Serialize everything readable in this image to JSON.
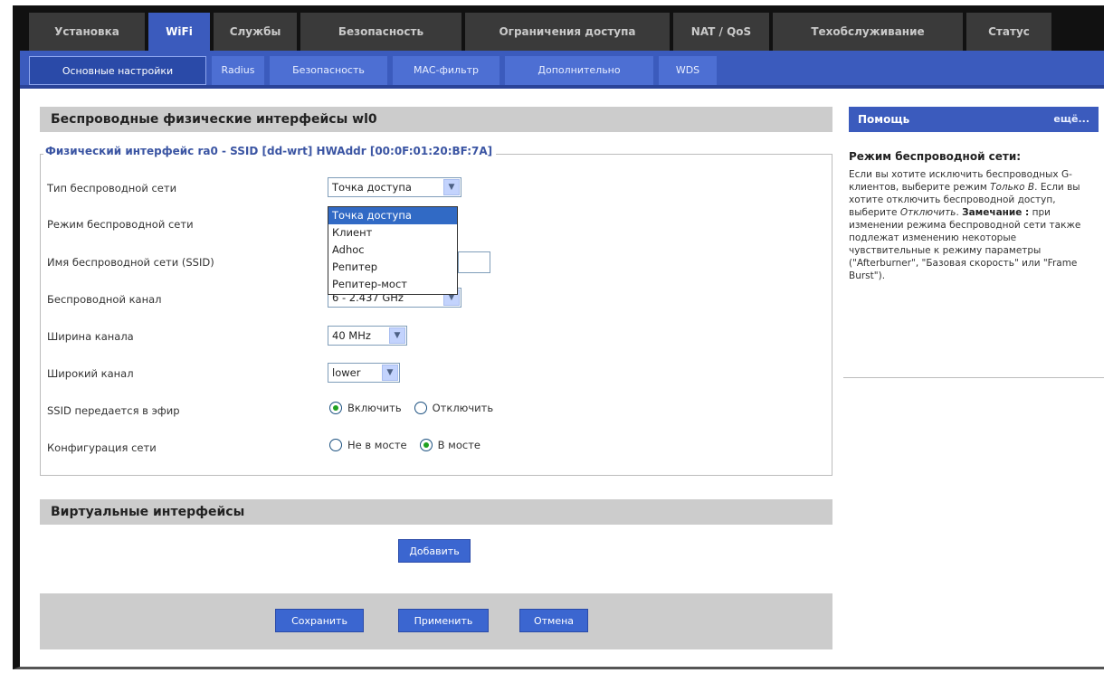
{
  "top_tabs": [
    "Установка",
    "WiFi",
    "Службы",
    "Безопасность",
    "Ограничения доступа",
    "NAT / QoS",
    "Техобслуживание",
    "Статус"
  ],
  "sub_tabs": [
    "Основные настройки",
    "Radius",
    "Безопасность",
    "MAC-фильтр",
    "Дополнительно",
    "WDS"
  ],
  "section": {
    "title": "Беспроводные физические интерфейсы wl0",
    "legend": "Физический интерфейс ra0 - SSID [dd-wrt] HWAddr [00:0F:01:20:BF:7A]"
  },
  "fields": {
    "wireless_type_label": "Тип беспроводной сети",
    "wireless_type_value": "Точка доступа",
    "wireless_mode_label": "Режим беспроводной сети",
    "ssid_label": "Имя беспроводной сети (SSID)",
    "channel_label": "Беспроводной канал",
    "channel_value": "6 - 2.437 GHz",
    "width_label": "Ширина канала",
    "width_value": "40 MHz",
    "wide_channel_label": "Широкий канал",
    "wide_channel_value": "lower",
    "broadcast_label": "SSID передается в эфир",
    "broadcast_enable": "Включить",
    "broadcast_disable": "Отключить",
    "network_config_label": "Конфигурация сети",
    "unbridged": "Не в мосте",
    "bridged": "В мосте"
  },
  "dropdown_options": [
    "Точка доступа",
    "Клиент",
    "Adhoc",
    "Репитер",
    "Репитер-мост"
  ],
  "virtual": {
    "title": "Виртуальные интерфейсы",
    "add_label": "Добавить"
  },
  "footer": {
    "save_label": "Сохранить",
    "apply_label": "Применить",
    "cancel_label": "Отмена"
  },
  "help": {
    "header": "Помощь",
    "more": "ещё...",
    "title": "Режим беспроводной сети:",
    "p1_a": "Если вы хотите исключить беспроводных G-клиентов, выберите режим ",
    "p1_b": "Только B",
    "p1_c": ". Если вы хотите отключить беспроводной доступ, выберите ",
    "p1_d": "Отключить",
    "p1_e": ".",
    "note_label": "Замечание :",
    "note_text": " при изменении режима беспроводной сети также подлежат изменению некоторые чувствительные к режиму параметры (\"Afterburner\", \"Базовая скорость\" или \"Frame Burst\")."
  },
  "colors": {
    "accent": "#3b5bbd",
    "topbar": "#111111",
    "section_bg": "#cccccc"
  }
}
